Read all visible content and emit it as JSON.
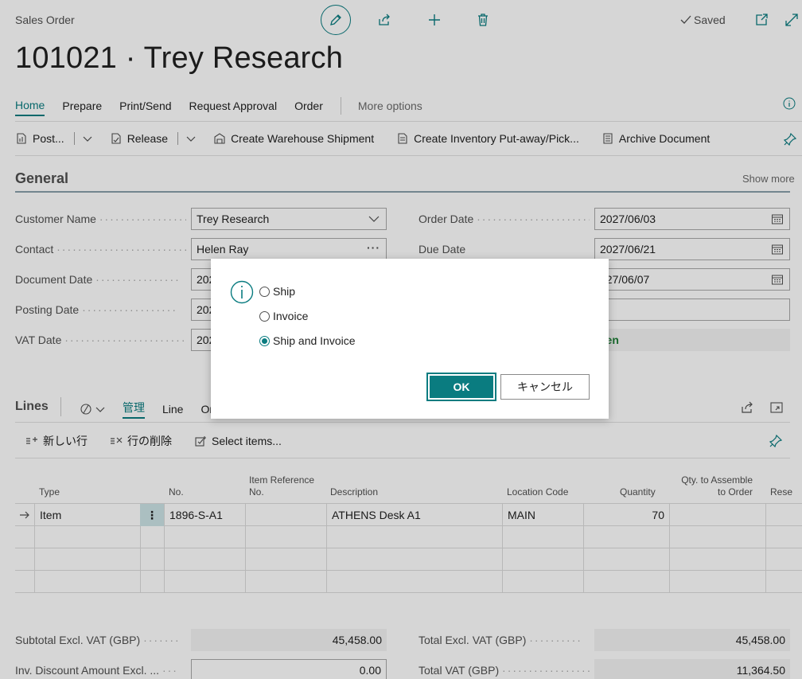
{
  "window": {
    "label": "Sales Order",
    "status": "Saved"
  },
  "page": {
    "title": "101021 · Trey Research"
  },
  "action_tabs": {
    "home": "Home",
    "prepare": "Prepare",
    "print_send": "Print/Send",
    "request_approval": "Request Approval",
    "order": "Order",
    "more_options": "More options"
  },
  "ribbon": {
    "post": "Post...",
    "release": "Release",
    "create_warehouse_shipment": "Create Warehouse Shipment",
    "create_inventory_putaway": "Create Inventory Put-away/Pick...",
    "archive_document": "Archive Document"
  },
  "general": {
    "title": "General",
    "show_more": "Show more",
    "customer_name": {
      "label": "Customer Name",
      "value": "Trey Research"
    },
    "contact": {
      "label": "Contact",
      "value": "Helen Ray"
    },
    "document_date": {
      "label": "Document Date",
      "value": "202"
    },
    "posting_date": {
      "label": "Posting Date",
      "value": "202"
    },
    "vat_date": {
      "label": "VAT Date",
      "value": "202"
    },
    "order_date": {
      "label": "Order Date",
      "value": "2027/06/03"
    },
    "due_date": {
      "label": "Due Date",
      "value": "2027/06/21"
    },
    "right_row3": {
      "value": "027/06/07"
    },
    "right_row4": {
      "value": ""
    },
    "status": {
      "value": "pen"
    }
  },
  "lines": {
    "title": "Lines",
    "tabs": {
      "manage": "管理",
      "line": "Line",
      "order_partial": "Or"
    },
    "ribbon": {
      "new_line": "新しい行",
      "delete_line": "行の削除",
      "select_items": "Select items..."
    },
    "headers": {
      "type": "Type",
      "no": "No.",
      "item_reference": "Item Reference\nNo.",
      "description": "Description",
      "location_code": "Location Code",
      "quantity": "Quantity",
      "qty_to_assemble": "Qty. to Assemble\nto Order",
      "reserved": "Rese"
    },
    "rows": [
      {
        "type": "Item",
        "no": "1896-S-A1",
        "item_reference": "",
        "description": "ATHENS Desk A1",
        "location": "MAIN",
        "quantity": "70",
        "qty_to_assemble": ""
      },
      {
        "type": "",
        "no": "",
        "item_reference": "",
        "description": "",
        "location": "",
        "quantity": "",
        "qty_to_assemble": ""
      },
      {
        "type": "",
        "no": "",
        "item_reference": "",
        "description": "",
        "location": "",
        "quantity": "",
        "qty_to_assemble": ""
      },
      {
        "type": "",
        "no": "",
        "item_reference": "",
        "description": "",
        "location": "",
        "quantity": "",
        "qty_to_assemble": ""
      }
    ]
  },
  "totals": {
    "subtotal": {
      "label": "Subtotal Excl. VAT (GBP)",
      "value": "45,458.00"
    },
    "inv_discount": {
      "label": "Inv. Discount Amount Excl. ...",
      "value": "0.00"
    },
    "total_excl": {
      "label": "Total Excl. VAT (GBP)",
      "value": "45,458.00"
    },
    "total_vat": {
      "label": "Total VAT (GBP)",
      "value": "11,364.50"
    }
  },
  "dialog": {
    "options": [
      "Ship",
      "Invoice",
      "Ship and Invoice"
    ],
    "selected": "Ship and Invoice",
    "ok": "OK",
    "cancel": "キャンセル"
  },
  "colors": {
    "accent": "#0a7c80",
    "status_green": "#1c7d35"
  }
}
